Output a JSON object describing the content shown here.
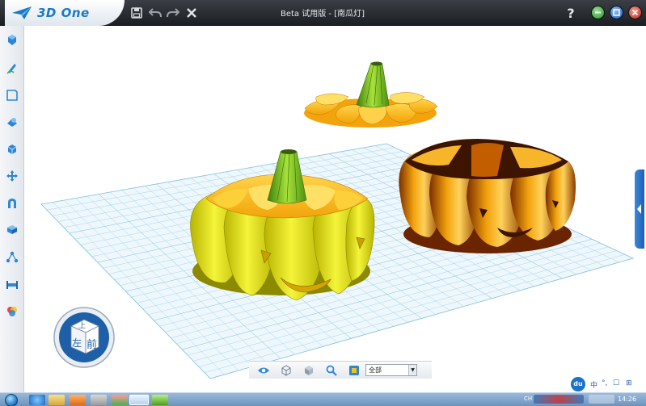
{
  "app": {
    "logo_text": "3D One",
    "window_title": "Beta 试用版 - [南瓜灯]"
  },
  "title_toolbar": {
    "icons": [
      "save-icon",
      "undo-icon",
      "redo-icon",
      "close-x-icon",
      "help-icon"
    ],
    "help_label": "?"
  },
  "window_controls": {
    "minimize_color": "#3fb53f",
    "restore_color": "#2f7fd6",
    "close_color": "#e03a2c"
  },
  "left_toolbar": {
    "items": [
      "basic-solid-icon",
      "sketch-icon",
      "sketch-edit-icon",
      "special-function-icon",
      "combine-icon",
      "move-icon",
      "magnet-snap-icon",
      "pattern-icon",
      "distance-measure-icon",
      "base-icon",
      "material-render-icon"
    ]
  },
  "view_cube": {
    "top_label": "上",
    "left_label": "左",
    "front_label": "前"
  },
  "bottom_toolbar": {
    "icons": [
      "view-eye-icon",
      "wireframe-cube-icon",
      "shaded-cube-icon",
      "zoom-icon",
      "snapshot-icon"
    ],
    "filter_value": "全部"
  },
  "floating_assistant": {
    "label": "du"
  },
  "ime_bar": {
    "items": [
      "中",
      "°,",
      "☐",
      "⊞"
    ]
  },
  "taskbar": {
    "tray_lang": "CH",
    "clock": "14:26"
  },
  "colors": {
    "grid_line": "#a9d4ea",
    "grid_major": "#7fbddc",
    "pumpkin_yellow": "#e6e61a",
    "pumpkin_orange": "#f29a0c",
    "stem_green": "#7cc21f"
  }
}
